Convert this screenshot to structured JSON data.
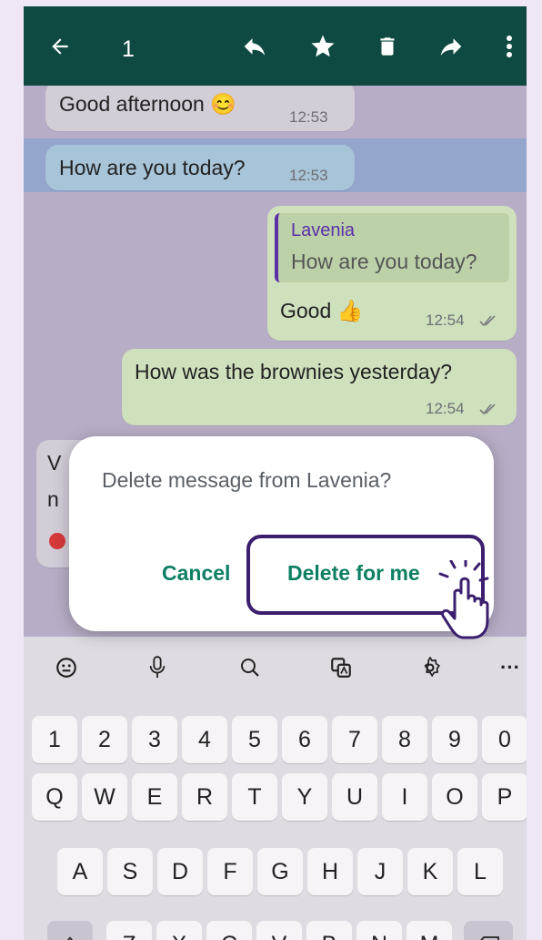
{
  "toolbar": {
    "selected_count": "1",
    "icons": [
      "back-arrow-icon",
      "reply-icon",
      "star-icon",
      "delete-icon",
      "forward-icon",
      "more-icon"
    ]
  },
  "messages": [
    {
      "text": "Good afternoon 😊",
      "time": "12:53",
      "direction": "incoming"
    },
    {
      "text": "How are you today?",
      "time": "12:53",
      "direction": "incoming",
      "selected": true
    },
    {
      "quote_author": "Lavenia",
      "quote_text": "How are you today?",
      "text": "Good 👍",
      "time": "12:54",
      "direction": "outgoing"
    },
    {
      "text": "How was the brownies yesterday?",
      "time": "12:54",
      "direction": "outgoing"
    },
    {
      "text_fragment_1": "V",
      "text_fragment_2": "n",
      "direction": "incoming"
    }
  ],
  "dialog": {
    "message": "Delete message from Lavenia?",
    "cancel": "Cancel",
    "delete_for_me": "Delete for me"
  },
  "keyboard": {
    "tools": [
      "emoji-sticker-icon",
      "mic-icon",
      "search-icon",
      "translate-icon",
      "settings-icon",
      "more-icon"
    ],
    "more_label": "···",
    "row_numbers": [
      "1",
      "2",
      "3",
      "4",
      "5",
      "6",
      "7",
      "8",
      "9",
      "0"
    ],
    "row_q": [
      "Q",
      "W",
      "E",
      "R",
      "T",
      "Y",
      "U",
      "I",
      "O",
      "P"
    ],
    "row_a": [
      "A",
      "S",
      "D",
      "F",
      "G",
      "H",
      "J",
      "K",
      "L"
    ],
    "row_z": [
      "Z",
      "X",
      "C",
      "V",
      "B",
      "N",
      "M"
    ]
  },
  "colors": {
    "toolbar": "#0e4a41",
    "accent": "#0d7f63",
    "fab": "#1aa058",
    "quote_bar": "#5a2fa8"
  }
}
